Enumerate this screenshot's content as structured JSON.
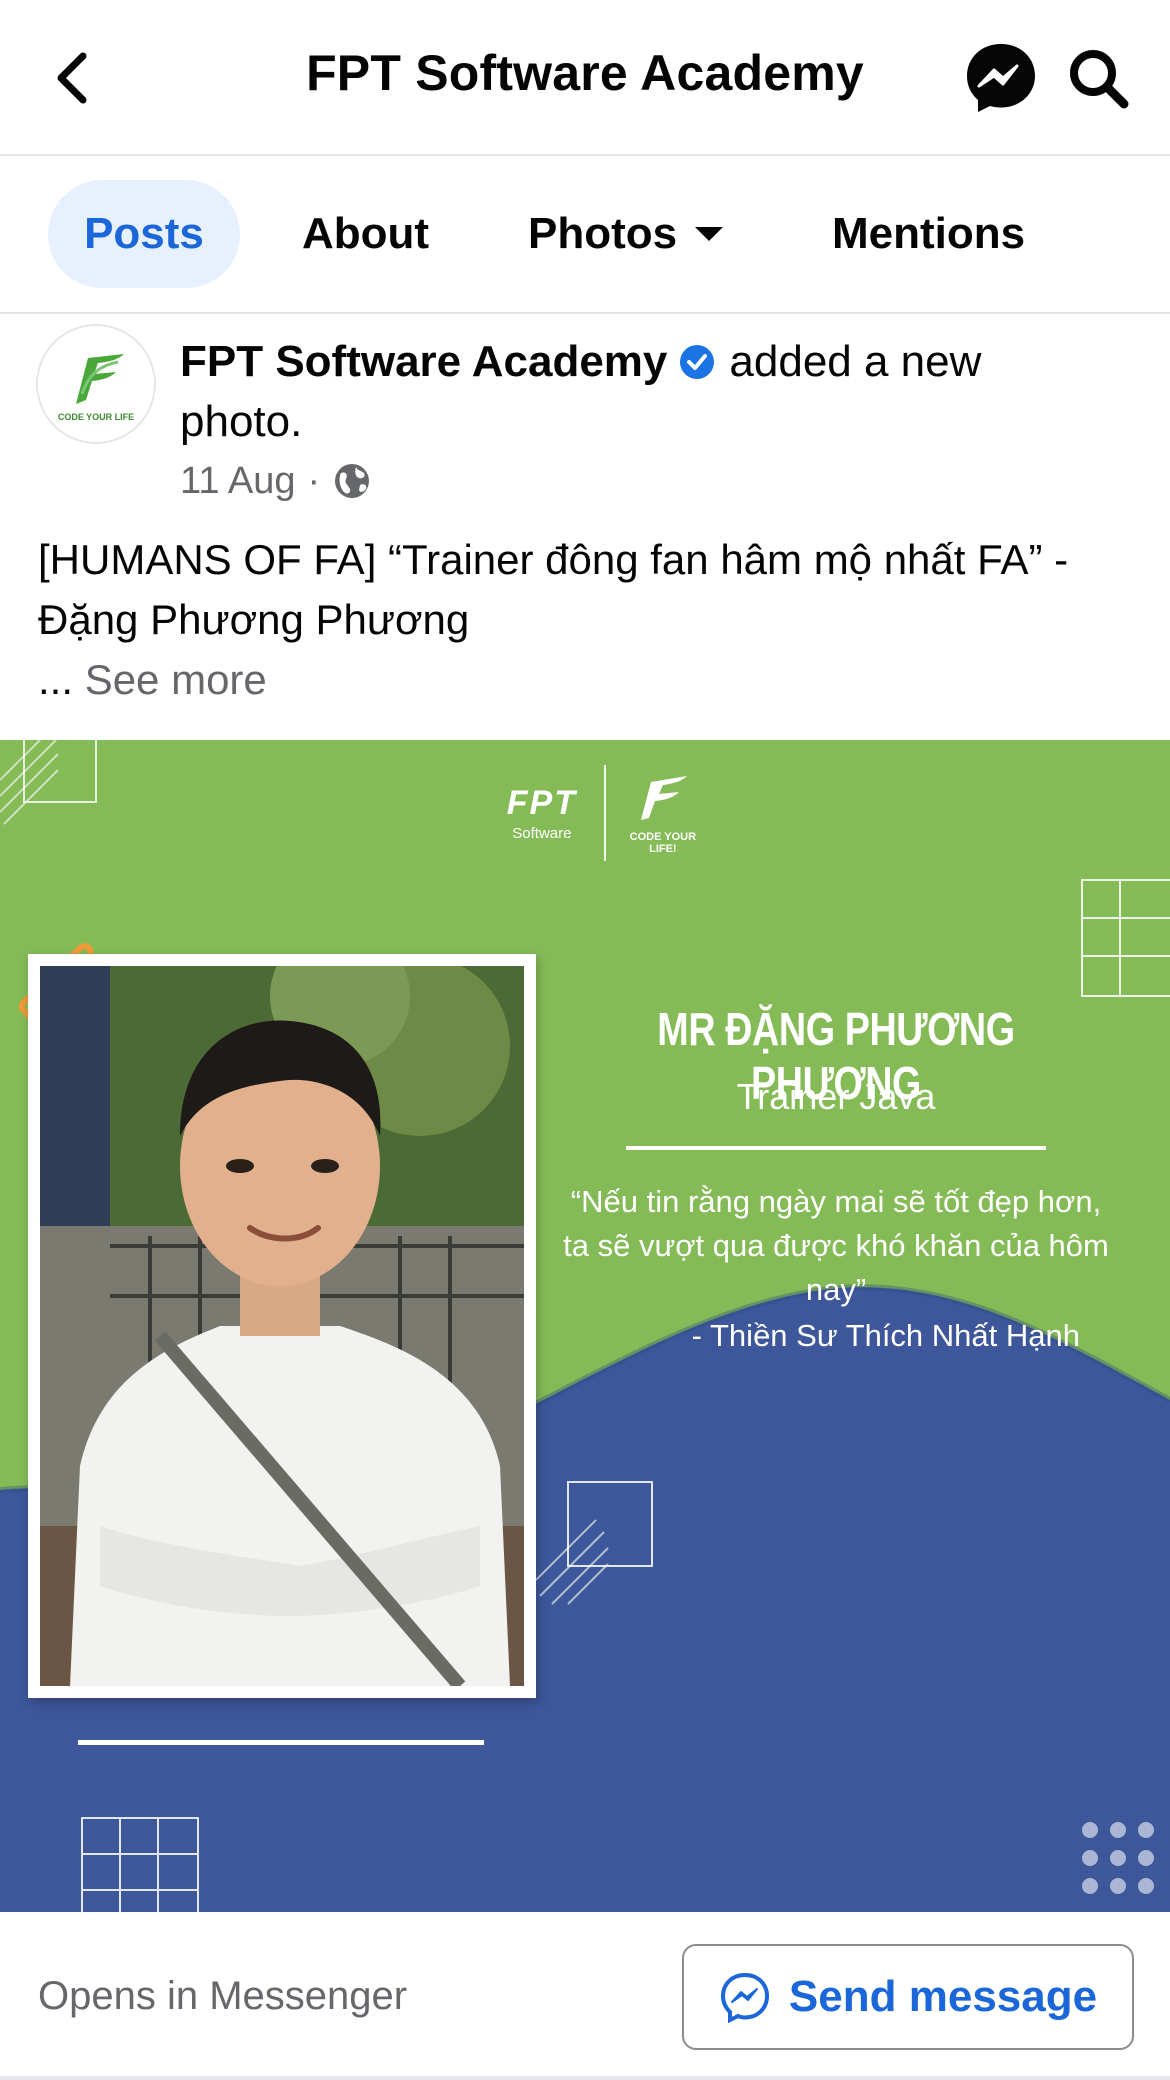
{
  "header": {
    "title": "FPT Software Academy"
  },
  "tabs": [
    {
      "label": "Posts",
      "active": true
    },
    {
      "label": "About"
    },
    {
      "label": "Photos"
    },
    {
      "label": "Mentions"
    }
  ],
  "post": {
    "page_name": "FPT Software Academy",
    "action": "added a new photo.",
    "date": "11 Aug",
    "meta_separator": "·",
    "text": "[HUMANS OF FA] “Trainer đông fan hâm mộ nhất FA” - Đặng Phương Phương",
    "ellipsis": "...",
    "see_more": "See more",
    "avatar_caption": "CODE YOUR LIFE"
  },
  "image": {
    "logo_fpt": "FPT",
    "logo_fpt_sub": "Software",
    "logo_fa_sub": "CODE YOUR LIFE!",
    "trainer_name": "MR ĐẶNG PHƯƠNG PHƯƠNG",
    "trainer_role": "Trainer Java",
    "quote": "“Nếu tin rằng ngày mai sẽ tốt đẹp hơn, ta sẽ vượt qua được khó khăn của hôm nay”",
    "quote_author": "- Thiền Sư Thích Nhất Hạnh",
    "colors": {
      "green": "#85bb57",
      "blue": "#3d579a"
    }
  },
  "footer": {
    "opens_text": "Opens in Messenger",
    "send_label": "Send message"
  },
  "colors": {
    "accent": "#1b66d8",
    "tab_active_bg": "#e7f0fd",
    "muted": "#65676b"
  }
}
